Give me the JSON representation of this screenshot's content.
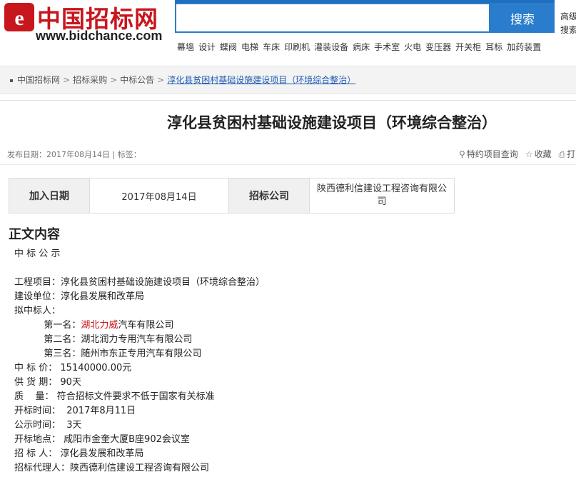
{
  "header": {
    "logo_text": "中国招标网",
    "logo_url": "www.bidchance.com",
    "search_placeholder": "",
    "search_button": "搜索",
    "right_snippet_1": "高级",
    "right_snippet_2": "搜索"
  },
  "hot_words": [
    "幕墙",
    "设计",
    "蝶阀",
    "电梯",
    "车床",
    "印刷机",
    "灌装设备",
    "病床",
    "手术室",
    "火电",
    "变压器",
    "开关柜",
    "耳标",
    "加药装置"
  ],
  "breadcrumb": {
    "items": [
      "中国招标网",
      "招标采购",
      "中标公告"
    ],
    "current": "淳化县贫困村基础设施建设项目（环境综合整治）",
    "separator": ">"
  },
  "article": {
    "title": "淳化县贫困村基础设施建设项目（环境综合整治）",
    "publish_date_label": "发布日期：2017年08月14日",
    "tags_label": "标签：",
    "track_link": "特约项目查询",
    "fav_link": "收藏",
    "print_link": "打"
  },
  "info_table": {
    "date_label": "加入日期",
    "date_value": "2017年08月14日",
    "company_label": "招标公司",
    "company_value": "陕西德利信建设工程咨询有限公司"
  },
  "content": {
    "section_title": "正文内容",
    "heading": "中 标 公 示",
    "project_line": "工程项目：淳化县贫困村基础设施建设项目（环境综合整治）",
    "unit_line": "建设单位：淳化县发展和改革局",
    "bidder_label": "拟中标人：",
    "rank1_prefix": "第一名：",
    "rank1_red": "湖北力威",
    "rank1_suffix": "汽车有限公司",
    "rank2": "第二名：湖北润力专用汽车有限公司",
    "rank3": "第三名：随州市东正专用汽车有限公司",
    "price_line": "中 标 价： 15140000.00元",
    "delivery_line": "供 货 期： 90天",
    "quality_line": "质    量： 符合招标文件要求不低于国家有关标准",
    "open_time_line": "开标时间：  2017年8月11日",
    "public_time_line": "公示时间：  3天",
    "location_line": "开标地点： 咸阳市金奎大厦B座902会议室",
    "tenderer_line": "招 标 人： 淳化县发展和改革局",
    "agent_line": "招标代理人：陕西德利信建设工程咨询有限公司"
  }
}
